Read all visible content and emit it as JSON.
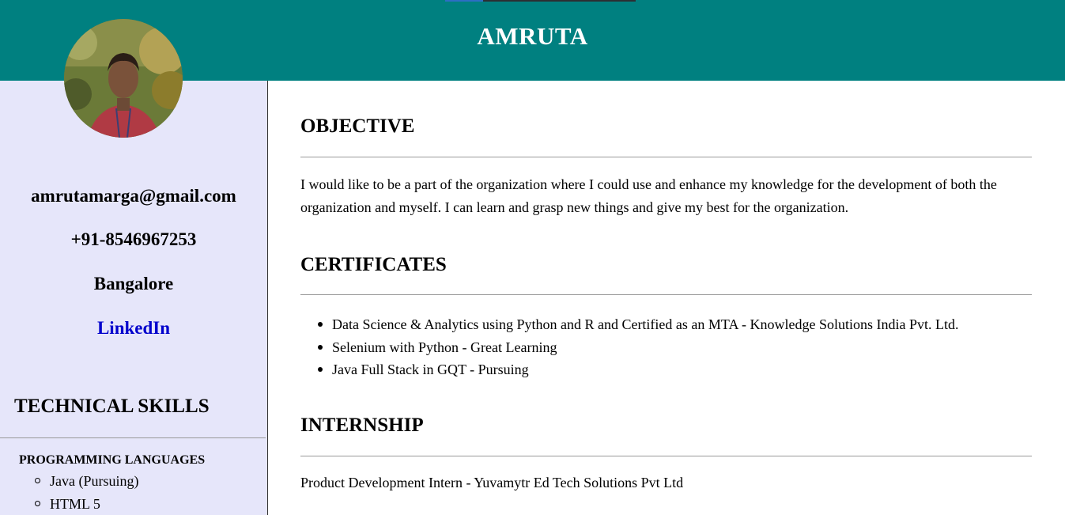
{
  "header": {
    "name": "AMRUTA"
  },
  "sidebar": {
    "email": "amrutamarga@gmail.com",
    "phone": "+91-8546967253",
    "city": "Bangalore",
    "linkedin": "LinkedIn",
    "skills_title": "TECHNICAL SKILLS",
    "programming_title": "PROGRAMMING LANGUAGES",
    "programming": [
      "Java (Pursuing)",
      "HTML 5"
    ]
  },
  "main": {
    "objective": {
      "title": "OBJECTIVE",
      "text": "I would like to be a part of the organization where I could use and enhance my knowledge for the development of both the organization and myself. I can learn and grasp new things and give my best for the organization."
    },
    "certificates": {
      "title": "CERTIFICATES",
      "items": [
        "Data Science & Analytics using Python and R and Certified as an MTA - Knowledge Solutions India Pvt. Ltd.",
        "Selenium with Python - Great Learning",
        "Java Full Stack in GQT - Pursuing"
      ]
    },
    "internship": {
      "title": "INTERNSHIP",
      "text": "Product Development Intern - Yuvamytr Ed Tech Solutions Pvt Ltd"
    }
  },
  "colors": {
    "header_bg": "#008080",
    "sidebar_bg": "#e6e6fa",
    "link": "#0000cc"
  }
}
